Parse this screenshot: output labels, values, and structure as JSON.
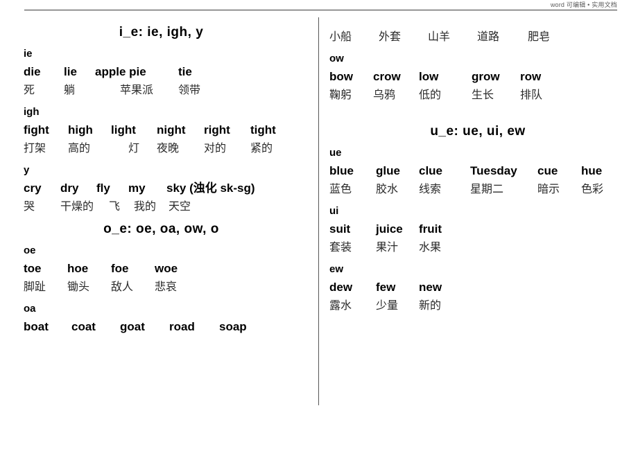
{
  "header": {
    "watermark": "word 可编辑 • 实用文档"
  },
  "left_column": {
    "section_i_e": {
      "title": "i_e: ie, igh, y",
      "groups": [
        {
          "label": "ie",
          "words": [
            "die",
            "lie",
            "apple pie",
            "tie"
          ],
          "translations": [
            "死",
            "躺",
            "苹果派",
            "领带"
          ]
        },
        {
          "label": "igh",
          "words": [
            "fight",
            "high",
            "light",
            "night",
            "right",
            "tight"
          ],
          "translations": [
            "打架",
            "高的",
            "灯",
            "夜晚",
            "对的",
            "紧的"
          ]
        },
        {
          "label": "y",
          "words": [
            "cry",
            "dry",
            "fly",
            "my",
            "sky (浊化 sk-sg)"
          ],
          "translations": [
            "哭",
            "干燥的",
            "飞",
            "我的",
            "天空"
          ]
        }
      ]
    },
    "section_o_e": {
      "title": "o_e: oe, oa, ow, o",
      "groups": [
        {
          "label": "oe",
          "words": [
            "toe",
            "hoe",
            "foe",
            "woe"
          ],
          "translations": [
            "脚趾",
            "锄头",
            "敌人",
            "悲哀"
          ]
        },
        {
          "label": "oa",
          "words": [
            "boat",
            "coat",
            "goat",
            "road",
            "soap"
          ],
          "translations": []
        }
      ]
    }
  },
  "right_column": {
    "section_o_e_continued": {
      "groups": [
        {
          "label": "",
          "words": [],
          "translations": [
            "小船",
            "外套",
            "山羊",
            "道路",
            "肥皂"
          ]
        },
        {
          "label": "ow",
          "words": [
            "bow",
            "crow",
            "low",
            "grow",
            "row"
          ],
          "translations": [
            "鞠躬",
            "乌鸦",
            "低的",
            "生长",
            "排队"
          ]
        }
      ]
    },
    "section_u_e": {
      "title": "u_e: ue, ui, ew",
      "groups": [
        {
          "label": "ue",
          "words": [
            "blue",
            "glue",
            "clue",
            "Tuesday",
            "cue",
            "hue"
          ],
          "translations": [
            "蓝色",
            "胶水",
            "线索",
            "星期二",
            "暗示",
            "色彩"
          ]
        },
        {
          "label": "ui",
          "words": [
            "suit",
            "juice",
            "fruit"
          ],
          "translations": [
            "套装",
            "果汁",
            "水果"
          ]
        },
        {
          "label": "ew",
          "words": [
            "dew",
            "few",
            "new"
          ],
          "translations": [
            "露水",
            "少量",
            "新的"
          ]
        }
      ]
    }
  }
}
